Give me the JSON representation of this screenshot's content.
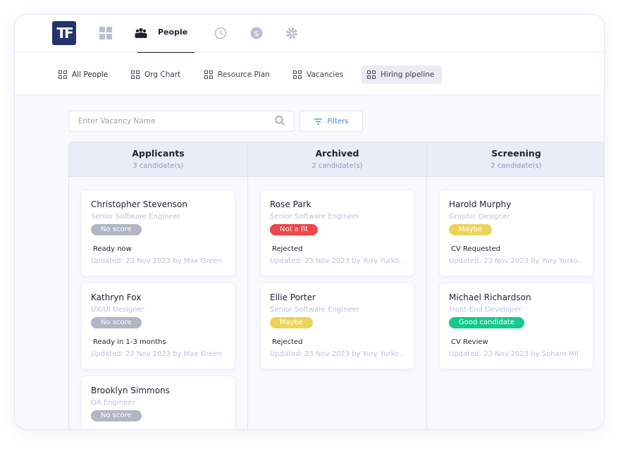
{
  "logo": "TF",
  "nav": {
    "people_label": "People"
  },
  "subnav": [
    "All People",
    "Org Chart",
    "Resource Plan",
    "Vacancies",
    "Hiring pipeline"
  ],
  "search": {
    "placeholder": "Enter Vacancy Name"
  },
  "filters_label": "Filters",
  "colors": {
    "no_score": "#b1b6c4",
    "not_fit": "#f0454a",
    "maybe": "#ecd45b",
    "good": "#14c98e"
  },
  "columns": [
    {
      "title": "Applicants",
      "count": "3 candidate(s)",
      "cards": [
        {
          "name": "Christopher Stevenson",
          "role": "Senior Software Engineer",
          "badge": "No score",
          "badge_color": "#b1b6c4",
          "status": "Ready now",
          "updated": "Updated: 23 Nov 2023 by Max Green"
        },
        {
          "name": "Kathryn Fox",
          "role": "UX/UI Designer",
          "badge": "No score",
          "badge_color": "#b1b6c4",
          "status": "Ready in 1-3 months",
          "updated": "Updated: 23 Nov 2023 by Max Green"
        },
        {
          "name": "Brooklyn Simmons",
          "role": "QA Engineer",
          "badge": "No score",
          "badge_color": "#b1b6c4",
          "status": "",
          "updated": ""
        }
      ]
    },
    {
      "title": "Archived",
      "count": "2 candidate(s)",
      "cards": [
        {
          "name": "Rose Park",
          "role": "Senior Software Engineer",
          "badge": "Not a fit",
          "badge_color": "#f0454a",
          "status": "Rejected",
          "updated": "Updated: 23 Nov 2023 by Yury Yurko..."
        },
        {
          "name": "Ellie Porter",
          "role": "Senior Software Engineer",
          "badge": "Maybe",
          "badge_color": "#ecd45b",
          "status": "Rejected",
          "updated": "Updated: 23 Nov 2023 by Yury Yurko..."
        }
      ]
    },
    {
      "title": "Screening",
      "count": "2 candidate(s)",
      "cards": [
        {
          "name": "Harold Murphy",
          "role": "Graphic Designer",
          "badge": "Maybe",
          "badge_color": "#ecd45b",
          "status": "CV Requested",
          "updated": "Updated: 23 Nov 2023 by Yury Yurko..."
        },
        {
          "name": "Michael Richardson",
          "role": "Front-End Developer",
          "badge": "Good candidate",
          "badge_color": "#14c98e",
          "status": "CV Review",
          "updated": "Updated: 23 Nov 2023 by Soham Mil..."
        }
      ]
    }
  ]
}
